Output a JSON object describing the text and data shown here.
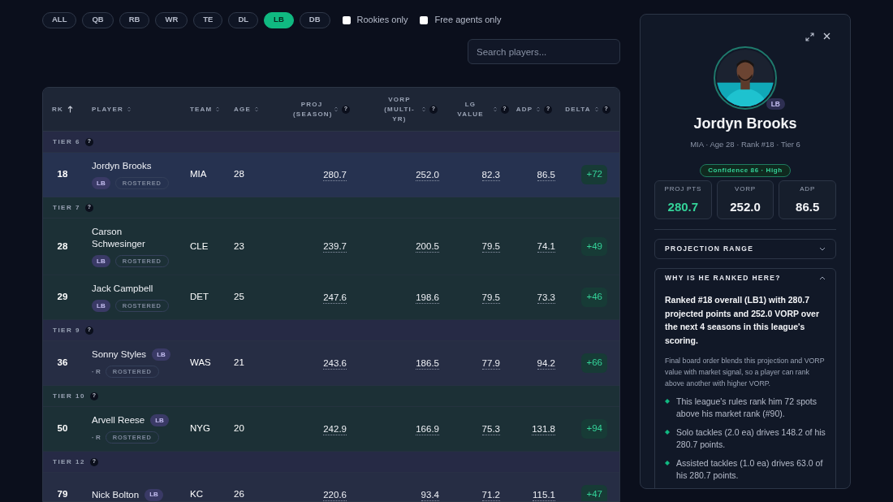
{
  "filters": {
    "positions": [
      {
        "label": "ALL",
        "selected": false
      },
      {
        "label": "QB",
        "selected": false
      },
      {
        "label": "RB",
        "selected": false
      },
      {
        "label": "WR",
        "selected": false
      },
      {
        "label": "TE",
        "selected": false
      },
      {
        "label": "DL",
        "selected": false
      },
      {
        "label": "LB",
        "selected": true
      },
      {
        "label": "DB",
        "selected": false
      }
    ],
    "checkboxes": [
      {
        "label": "Rookies only",
        "checked": false
      },
      {
        "label": "Free agents only",
        "checked": false
      }
    ],
    "search": {
      "placeholder": "Search players..."
    }
  },
  "table": {
    "columns": [
      {
        "label": "RK",
        "sorted": true
      },
      {
        "label": "PLAYER",
        "sorted": false
      },
      {
        "label": "TEAM",
        "sorted": false
      },
      {
        "label": "AGE",
        "sorted": false
      },
      {
        "label": "PROJ (SEASON)",
        "sorted": false,
        "help": "?"
      },
      {
        "label": "VORP (MULTI-YR)",
        "sorted": false,
        "help": "?"
      },
      {
        "label": "LG VALUE",
        "sorted": false,
        "help": "?"
      },
      {
        "label": "ADP",
        "sorted": false,
        "help": "?"
      },
      {
        "label": "DELTA",
        "sorted": false,
        "help": "?"
      }
    ],
    "tiers": [
      {
        "label": "TIER 6",
        "help": "?",
        "rows": [
          {
            "rank": "18",
            "name": "Jordyn Brooks",
            "pos": "LB",
            "badge_inline": false,
            "rookie": null,
            "tag": "ROSTERED",
            "team": "MIA",
            "age": "28",
            "proj": "280.7",
            "vorp": "252.0",
            "lg_value": "82.3",
            "adp": "86.5",
            "delta": "+72",
            "selected": true
          }
        ]
      },
      {
        "label": "TIER 7",
        "help": "?",
        "rows": [
          {
            "rank": "28",
            "name": "Carson Schwesinger",
            "pos": "LB",
            "badge_inline": false,
            "rookie": null,
            "tag": "ROSTERED",
            "team": "CLE",
            "age": "23",
            "proj": "239.7",
            "vorp": "200.5",
            "lg_value": "79.5",
            "adp": "74.1",
            "delta": "+49",
            "selected": false
          },
          {
            "rank": "29",
            "name": "Jack Campbell",
            "pos": "LB",
            "badge_inline": false,
            "rookie": null,
            "tag": "ROSTERED",
            "team": "DET",
            "age": "25",
            "proj": "247.6",
            "vorp": "198.6",
            "lg_value": "79.5",
            "adp": "73.3",
            "delta": "+46",
            "selected": false
          }
        ]
      },
      {
        "label": "TIER 9",
        "help": "?",
        "rows": [
          {
            "rank": "36",
            "name": "Sonny Styles",
            "pos": "LB",
            "badge_inline": true,
            "rookie": "· R",
            "tag": "ROSTERED",
            "team": "WAS",
            "age": "21",
            "proj": "243.6",
            "vorp": "186.5",
            "lg_value": "77.9",
            "adp": "94.2",
            "delta": "+66",
            "selected": false
          }
        ]
      },
      {
        "label": "TIER 10",
        "help": "?",
        "rows": [
          {
            "rank": "50",
            "name": "Arvell Reese",
            "pos": "LB",
            "badge_inline": true,
            "rookie": "· R",
            "tag": "ROSTERED",
            "team": "NYG",
            "age": "20",
            "proj": "242.9",
            "vorp": "166.9",
            "lg_value": "75.3",
            "adp": "131.8",
            "delta": "+94",
            "selected": false
          }
        ]
      },
      {
        "label": "TIER 12",
        "help": "?",
        "rows": [
          {
            "rank": "79",
            "name": "Nick Bolton",
            "pos": "LB",
            "badge_inline": true,
            "rookie": null,
            "tag": null,
            "team": "KC",
            "age": "26",
            "proj": "220.6",
            "vorp": "93.4",
            "lg_value": "71.2",
            "adp": "115.1",
            "delta": "+47",
            "selected": false
          }
        ]
      }
    ]
  },
  "detail": {
    "pos": "LB",
    "name": "Jordyn Brooks",
    "meta": "MIA · Age 28 · Rank #18 · Tier 6",
    "confidence": "Confidence 86 · High",
    "stats": [
      {
        "label": "PROJ PTS",
        "value": "280.7",
        "highlight": true
      },
      {
        "label": "VORP",
        "value": "252.0",
        "highlight": false
      },
      {
        "label": "ADP",
        "value": "86.5",
        "highlight": false
      }
    ],
    "sections": [
      {
        "title": "PROJECTION RANGE",
        "expanded": false
      },
      {
        "title": "WHY IS HE RANKED HERE?",
        "expanded": true,
        "summary": "Ranked #18 overall (LB1) with 280.7 projected points and 252.0 VORP over the next 4 seasons in this league's scoring.",
        "note": "Final board order blends this projection and VORP value with market signal, so a player can rank above another with higher VORP.",
        "bullets": [
          "This league's rules rank him 72 spots above his market rank (#90).",
          "Solo tackles (2.0 ea) drives 148.2 of his 280.7 points.",
          "Assisted tackles (1.0 ea) drives 63.0 of his 280.7 points."
        ]
      }
    ]
  }
}
